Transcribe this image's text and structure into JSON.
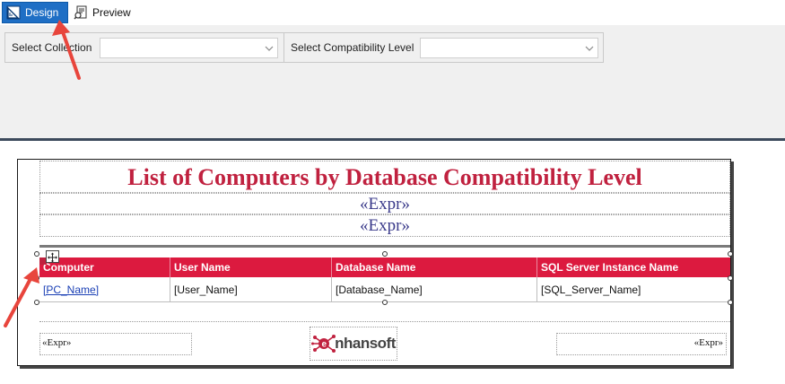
{
  "toolbar": {
    "design_label": "Design",
    "preview_label": "Preview"
  },
  "parameters": {
    "collection_label": "Select Collection",
    "collection_value": "",
    "compat_label": "Select Compatibility Level",
    "compat_value": ""
  },
  "report": {
    "title": "List of Computers by Database Compatibility Level",
    "expr_1": "«Expr»",
    "expr_2": "«Expr»",
    "table": {
      "headers": [
        "Computer",
        "User Name",
        "Database Name",
        "SQL Server Instance Name"
      ],
      "row": [
        "[PC_Name]",
        "[User_Name]",
        "[Database_Name]",
        "[SQL_Server_Name]"
      ]
    },
    "footer": {
      "left_expr": "«Expr»",
      "right_expr": "«Expr»",
      "logo_text": "nhansoft"
    }
  },
  "colors": {
    "accent": "#1f6fc5",
    "title": "#c0213f",
    "header_bg": "#dc1a3f",
    "annotation": "#e8453c"
  }
}
